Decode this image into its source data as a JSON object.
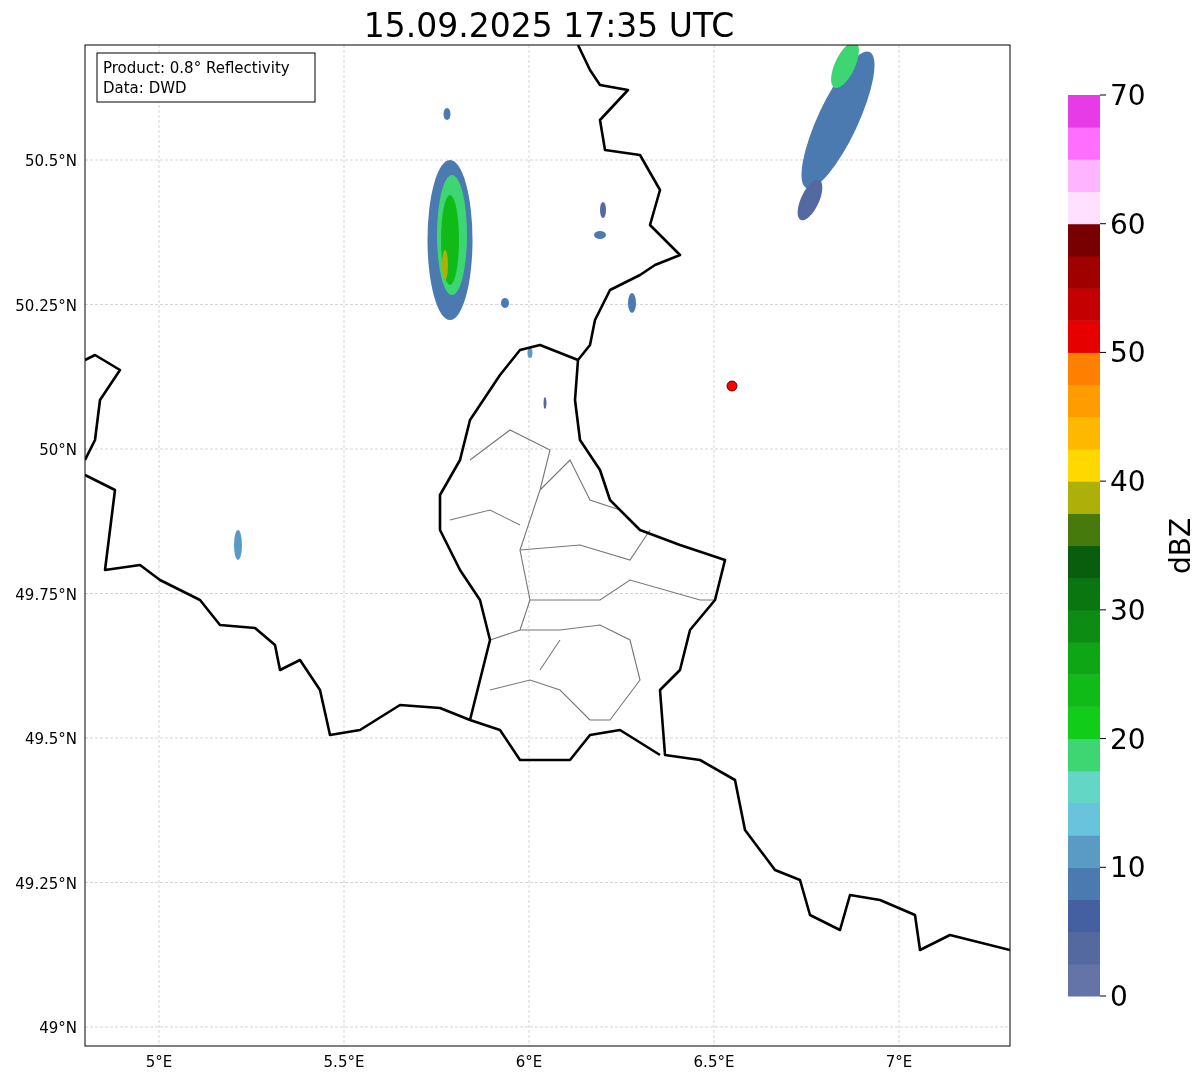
{
  "title": "15.09.2025 17:35 UTC",
  "map": {
    "legend_lines": [
      "Product: 0.8° Reflectivity",
      "Data: DWD"
    ],
    "xticks": [
      "5°E",
      "5.5°E",
      "6°E",
      "6.5°E",
      "7°E"
    ],
    "yticks": [
      "50.5°N",
      "50.25°N",
      "50°N",
      "49.75°N",
      "49.5°N",
      "49.25°N",
      "49°N"
    ]
  },
  "colorbar": {
    "label": "dBZ",
    "ticks": [
      "70",
      "60",
      "50",
      "40",
      "30",
      "20",
      "10",
      "0"
    ],
    "segments": [
      {
        "color": "#6474a8"
      },
      {
        "color": "#5369a0"
      },
      {
        "color": "#4560a0"
      },
      {
        "color": "#4a7ab0"
      },
      {
        "color": "#5a9bc6"
      },
      {
        "color": "#68c3dc"
      },
      {
        "color": "#63d6c6"
      },
      {
        "color": "#3dd673"
      },
      {
        "color": "#12cc1a"
      },
      {
        "color": "#10bb18"
      },
      {
        "color": "#0fa616"
      },
      {
        "color": "#0c8c12"
      },
      {
        "color": "#0a7610"
      },
      {
        "color": "#085e0c"
      },
      {
        "color": "#477a0d"
      },
      {
        "color": "#aeb00a"
      },
      {
        "color": "#ffd800"
      },
      {
        "color": "#ffb800"
      },
      {
        "color": "#ff9c00"
      },
      {
        "color": "#ff7f00"
      },
      {
        "color": "#e60000"
      },
      {
        "color": "#c40000"
      },
      {
        "color": "#a00000"
      },
      {
        "color": "#780000"
      },
      {
        "color": "#ffe0ff"
      },
      {
        "color": "#ffb4ff"
      },
      {
        "color": "#ff6eff"
      },
      {
        "color": "#e83be8"
      }
    ]
  }
}
